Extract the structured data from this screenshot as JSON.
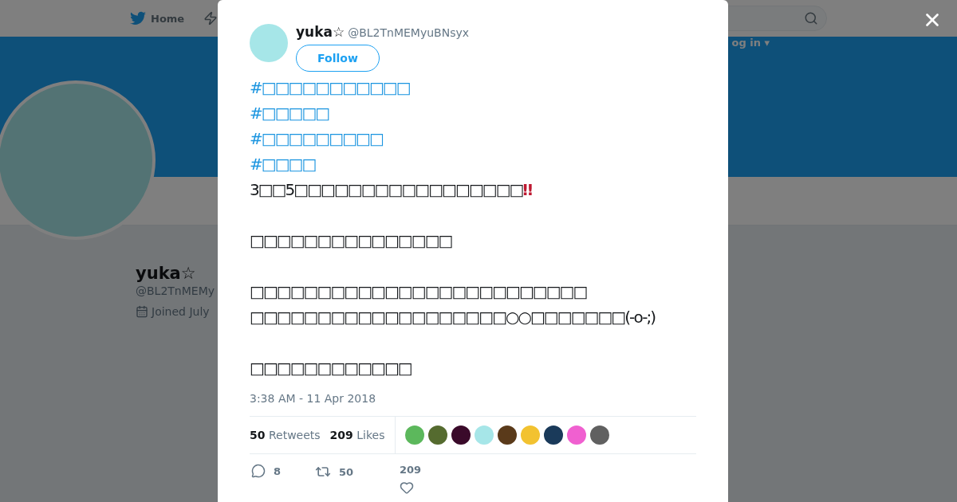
{
  "nav": {
    "home": "Home",
    "login": "og in ▾"
  },
  "profile": {
    "name": "yuka☆",
    "handle": "@BL2TnMEMy",
    "joined": "Joined July"
  },
  "tweet": {
    "name": "yuka☆",
    "handle": "@BL2TnMEMyuBNsyx",
    "follow": "Follow",
    "paragraphs": [
      [
        {
          "kind": "hashtag",
          "text": "#□□□□□□□□□□□"
        },
        {
          "kind": "hashtag",
          "text": "#□□□□□"
        },
        {
          "kind": "hashtag",
          "text": "#□□□□□□□□□"
        },
        {
          "kind": "hashtag",
          "text": "#□□□□"
        },
        {
          "kind": "text",
          "text": "3□□5□□□□□□□□□□□□□□□□□",
          "emoji": "‼"
        }
      ],
      [
        {
          "kind": "text",
          "text": "□□□□□□□□□□□□□□□"
        }
      ],
      [
        {
          "kind": "text",
          "text": "□□□□□□□□□□□□□□□□□□□□□□□□□"
        },
        {
          "kind": "text",
          "text": "□□□□□□□□□□□□□□□□□□□○○□□□□□□□(-o-;)"
        }
      ],
      [
        {
          "kind": "text",
          "text": "□□□□□□□□□□□□"
        }
      ]
    ],
    "timestamp": "3:38 AM - 11 Apr 2018",
    "stats": [
      {
        "count": "50",
        "label": "Retweets"
      },
      {
        "count": "209",
        "label": "Likes"
      }
    ],
    "likers": [
      {
        "color": "#5cb85c"
      },
      {
        "color": "#556b2f"
      },
      {
        "color": "#3a0a2a"
      },
      {
        "color": "#a6e6e8"
      },
      {
        "color": "#5a3a1a"
      },
      {
        "color": "#f2c230"
      },
      {
        "color": "#1a3a5a"
      },
      {
        "color": "#f060d0"
      },
      {
        "color": "#606060"
      }
    ],
    "actions": {
      "replies": "8",
      "retweets": "50",
      "likes": "209"
    }
  }
}
